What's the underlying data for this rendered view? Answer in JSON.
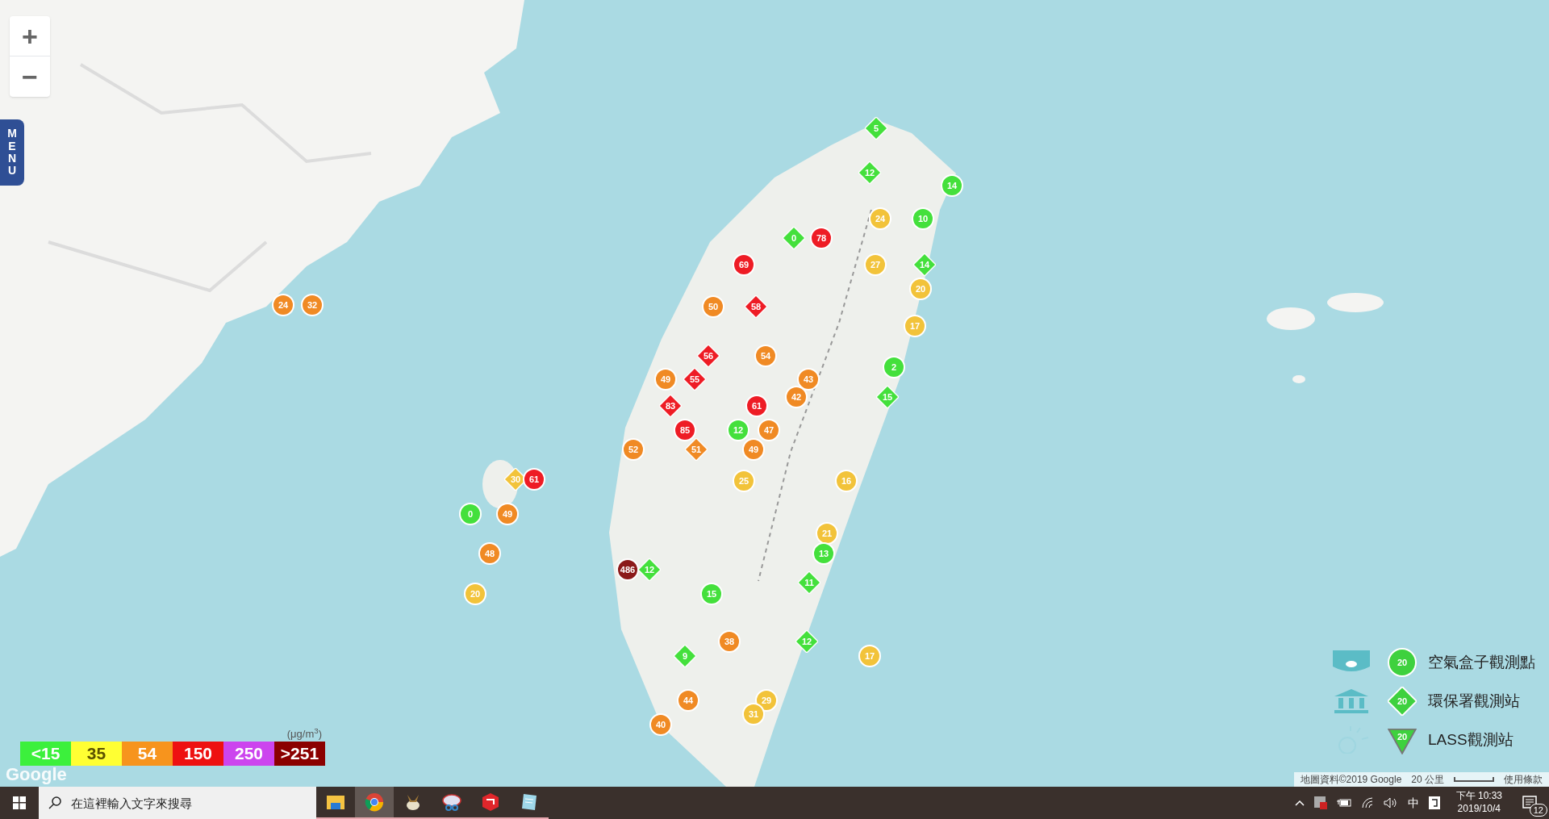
{
  "map_controls": {
    "zoom_in": "+",
    "zoom_out": "−",
    "menu": "MENU"
  },
  "markers": [
    {
      "kind": "diamond",
      "value": "5",
      "color": "#44e03c"
    },
    {
      "kind": "diamond",
      "value": "12",
      "color": "#44e03c"
    },
    {
      "kind": "circle",
      "value": "14",
      "color": "#44e03c"
    },
    {
      "kind": "circle",
      "value": "24",
      "color": "#f2c33a"
    },
    {
      "kind": "circle",
      "value": "10",
      "color": "#44e03c"
    },
    {
      "kind": "diamond",
      "value": "0",
      "color": "#44e03c"
    },
    {
      "kind": "circle",
      "value": "78",
      "color": "#ee1c25"
    },
    {
      "kind": "circle",
      "value": "69",
      "color": "#ee1c25"
    },
    {
      "kind": "circle",
      "value": "27",
      "color": "#f2c33a"
    },
    {
      "kind": "diamond",
      "value": "14",
      "color": "#44e03c"
    },
    {
      "kind": "circle",
      "value": "20",
      "color": "#f2c33a"
    },
    {
      "kind": "circle",
      "value": "24",
      "color": "#f08a24"
    },
    {
      "kind": "circle",
      "value": "32",
      "color": "#f08a24"
    },
    {
      "kind": "circle",
      "value": "50",
      "color": "#f08a24"
    },
    {
      "kind": "diamond",
      "value": "58",
      "color": "#ee1c25"
    },
    {
      "kind": "circle",
      "value": "17",
      "color": "#f2c33a"
    },
    {
      "kind": "diamond",
      "value": "56",
      "color": "#ee1c25"
    },
    {
      "kind": "circle",
      "value": "54",
      "color": "#f08a24"
    },
    {
      "kind": "circle",
      "value": "2",
      "color": "#44e03c"
    },
    {
      "kind": "circle",
      "value": "49",
      "color": "#f08a24"
    },
    {
      "kind": "diamond",
      "value": "55",
      "color": "#ee1c25"
    },
    {
      "kind": "circle",
      "value": "43",
      "color": "#f08a24"
    },
    {
      "kind": "circle",
      "value": "42",
      "color": "#f08a24"
    },
    {
      "kind": "diamond",
      "value": "15",
      "color": "#44e03c"
    },
    {
      "kind": "diamond",
      "value": "83",
      "color": "#ee1c25"
    },
    {
      "kind": "circle",
      "value": "61",
      "color": "#ee1c25"
    },
    {
      "kind": "circle",
      "value": "85",
      "color": "#ee1c25"
    },
    {
      "kind": "circle",
      "value": "12",
      "color": "#44e03c"
    },
    {
      "kind": "circle",
      "value": "47",
      "color": "#f08a24"
    },
    {
      "kind": "circle",
      "value": "52",
      "color": "#f08a24"
    },
    {
      "kind": "diamond",
      "value": "51",
      "color": "#f08a24"
    },
    {
      "kind": "circle",
      "value": "49",
      "color": "#f08a24"
    },
    {
      "kind": "diamond",
      "value": "30",
      "color": "#f2c33a"
    },
    {
      "kind": "circle",
      "value": "61",
      "color": "#ee1c25"
    },
    {
      "kind": "circle",
      "value": "25",
      "color": "#f2c33a"
    },
    {
      "kind": "circle",
      "value": "16",
      "color": "#f2c33a"
    },
    {
      "kind": "circle",
      "value": "0",
      "color": "#44e03c"
    },
    {
      "kind": "circle",
      "value": "49",
      "color": "#f08a24"
    },
    {
      "kind": "circle",
      "value": "21",
      "color": "#f2c33a"
    },
    {
      "kind": "circle",
      "value": "48",
      "color": "#f08a24"
    },
    {
      "kind": "circle",
      "value": "13",
      "color": "#44e03c"
    },
    {
      "kind": "circle",
      "value": "486",
      "color": "#8b1a1a"
    },
    {
      "kind": "diamond",
      "value": "12",
      "color": "#44e03c"
    },
    {
      "kind": "diamond",
      "value": "11",
      "color": "#44e03c"
    },
    {
      "kind": "circle",
      "value": "20",
      "color": "#f2c33a"
    },
    {
      "kind": "circle",
      "value": "15",
      "color": "#44e03c"
    },
    {
      "kind": "circle",
      "value": "38",
      "color": "#f08a24"
    },
    {
      "kind": "diamond",
      "value": "12",
      "color": "#44e03c"
    },
    {
      "kind": "diamond",
      "value": "9",
      "color": "#44e03c"
    },
    {
      "kind": "circle",
      "value": "17",
      "color": "#f2c33a"
    },
    {
      "kind": "circle",
      "value": "44",
      "color": "#f08a24"
    },
    {
      "kind": "circle",
      "value": "29",
      "color": "#f2c33a"
    },
    {
      "kind": "circle",
      "value": "31",
      "color": "#f2c33a"
    },
    {
      "kind": "circle",
      "value": "40",
      "color": "#f08a24"
    }
  ],
  "scale_legend": {
    "unit": "(μg/m$^{3}$)",
    "items": [
      {
        "label": "<15",
        "color": "#3cf03c"
      },
      {
        "label": "35",
        "color": "#ffff33"
      },
      {
        "label": "54",
        "color": "#f7941d"
      },
      {
        "label": "150",
        "color": "#ee1111"
      },
      {
        "label": "250",
        "color": "#cc44ee"
      },
      {
        "label": ">251",
        "color": "#8b0000"
      }
    ]
  },
  "map_logo": "Google",
  "station_legend": [
    {
      "kind": "circle",
      "value": "20",
      "label": "空氣盒子觀測點"
    },
    {
      "kind": "diamond",
      "value": "20",
      "label": "環保署觀測站"
    },
    {
      "kind": "triangle",
      "value": "20",
      "label": "LASS觀測站"
    }
  ],
  "attribution": {
    "data": "地圖資料©2019 Google",
    "scale": "20 公里",
    "terms": "使用條款"
  },
  "taskbar": {
    "search_placeholder": "在這裡輸入文字來搜尋",
    "apps": [
      {
        "kind": "folder",
        "selected": false
      },
      {
        "kind": "browser",
        "selected": true
      },
      {
        "kind": "squirrel",
        "selected": false
      },
      {
        "kind": "snip",
        "selected": false
      },
      {
        "kind": "sketchup",
        "selected": false
      },
      {
        "kind": "notepad",
        "selected": false
      }
    ],
    "ime": "中",
    "time": "下午 10:33",
    "date": "2019/10/4",
    "notifications": "12"
  }
}
